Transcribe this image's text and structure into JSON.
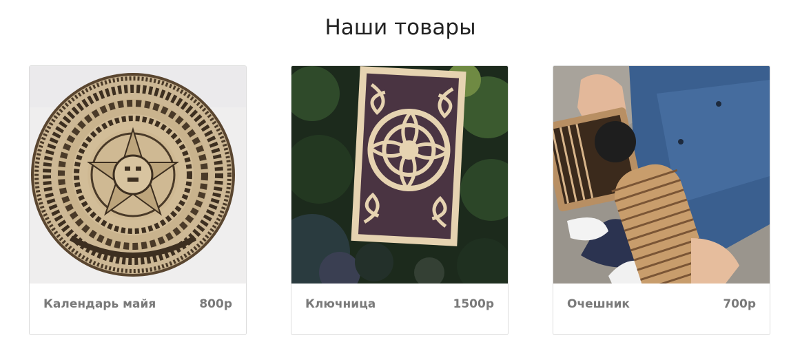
{
  "section": {
    "title": "Наши товары"
  },
  "products": [
    {
      "name": "Календарь майя",
      "price": "800р",
      "image": "mayan-calendar-image"
    },
    {
      "name": "Ключница",
      "price": "1500р",
      "image": "key-holder-image"
    },
    {
      "name": "Очешник",
      "price": "700р",
      "image": "glasses-case-image"
    }
  ],
  "colors": {
    "text": "#7a7a7a",
    "title": "#222222",
    "border": "#dcdcdc",
    "wood": "#d8c29c"
  }
}
